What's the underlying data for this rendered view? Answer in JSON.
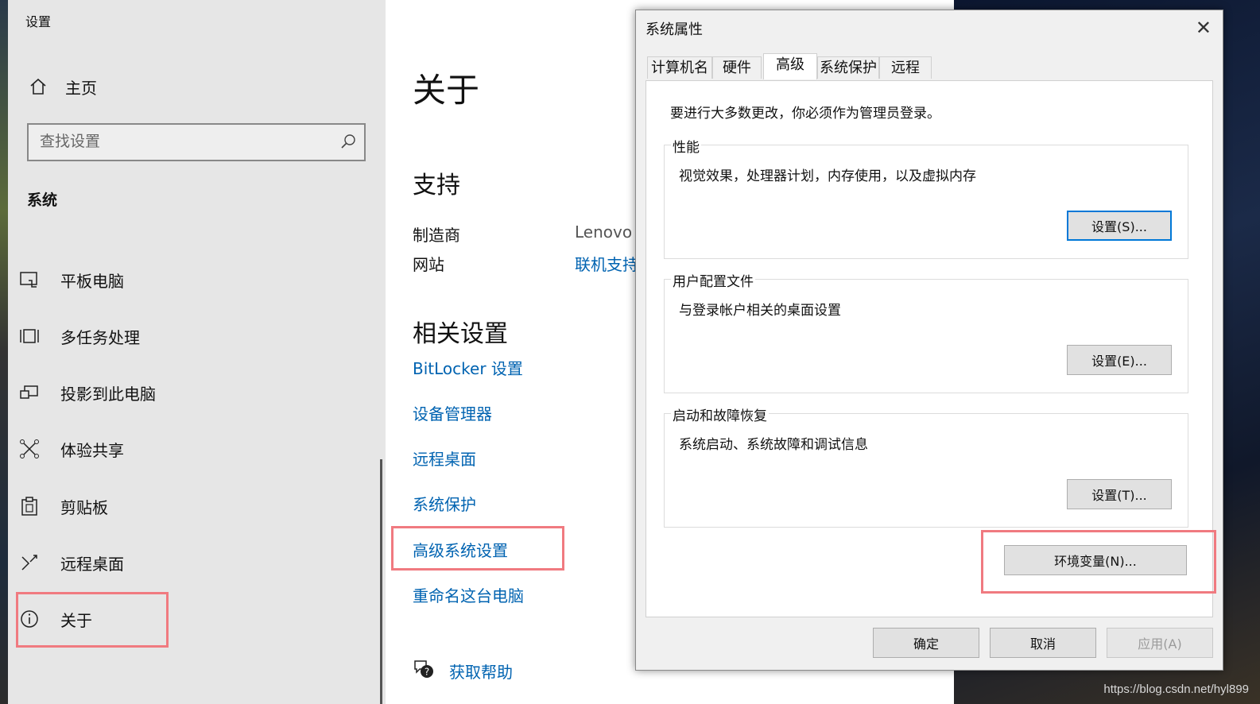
{
  "settings": {
    "window_title": "设置",
    "home_label": "主页",
    "search_placeholder": "查找设置",
    "section_title": "系统",
    "nav_items": [
      {
        "label": "平板电脑",
        "icon": "tablet-icon"
      },
      {
        "label": "多任务处理",
        "icon": "multitask-icon"
      },
      {
        "label": "投影到此电脑",
        "icon": "project-icon"
      },
      {
        "label": "体验共享",
        "icon": "share-icon"
      },
      {
        "label": "剪贴板",
        "icon": "clipboard-icon"
      },
      {
        "label": "远程桌面",
        "icon": "remote-icon"
      },
      {
        "label": "关于",
        "icon": "info-icon"
      }
    ]
  },
  "main": {
    "page_title": "关于",
    "support": {
      "heading": "支持",
      "manufacturer_label": "制造商",
      "manufacturer_value": "Lenovo",
      "website_label": "网站",
      "website_value": "联机支持"
    },
    "related": {
      "heading": "相关设置",
      "links": [
        "BitLocker 设置",
        "设备管理器",
        "远程桌面",
        "系统保护",
        "高级系统设置",
        "重命名这台电脑"
      ]
    },
    "help_label": "获取帮助"
  },
  "dialog": {
    "title": "系统属性",
    "tabs": [
      "计算机名",
      "硬件",
      "高级",
      "系统保护",
      "远程"
    ],
    "active_tab": "高级",
    "note": "要进行大多数更改，你必须作为管理员登录。",
    "groups": [
      {
        "legend": "性能",
        "desc": "视觉效果，处理器计划，内存使用，以及虚拟内存",
        "button": "设置(S)..."
      },
      {
        "legend": "用户配置文件",
        "desc": "与登录帐户相关的桌面设置",
        "button": "设置(E)..."
      },
      {
        "legend": "启动和故障恢复",
        "desc": "系统启动、系统故障和调试信息",
        "button": "设置(T)..."
      }
    ],
    "env_button": "环境变量(N)...",
    "ok": "确定",
    "cancel": "取消",
    "apply": "应用(A)"
  },
  "watermark": "https://blog.csdn.net/hyl899",
  "colors": {
    "link": "#0063b1",
    "highlight": "#f07a80",
    "focus": "#0078d7"
  }
}
